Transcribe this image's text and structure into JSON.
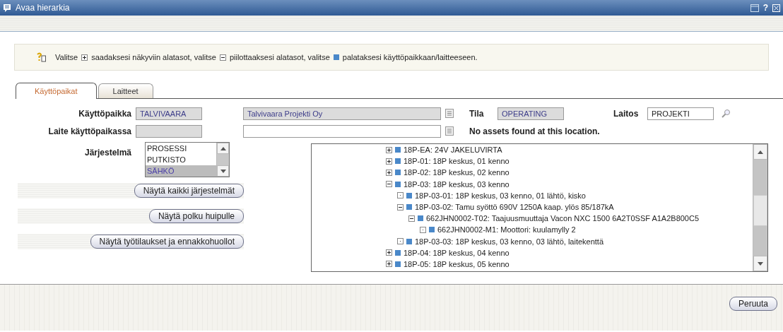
{
  "window": {
    "title": "Avaa hierarkia",
    "help": "?"
  },
  "hint": {
    "segments": [
      {
        "kind": "text",
        "text": "Valitse"
      },
      {
        "kind": "plus"
      },
      {
        "kind": "text",
        "text": "saadaksesi näkyviin alatasot, valitse"
      },
      {
        "kind": "minus"
      },
      {
        "kind": "text",
        "text": "piilottaaksesi alatasot, valitse"
      },
      {
        "kind": "square"
      },
      {
        "kind": "text",
        "text": "palataksesi käyttöpaikkaan/laitteeseen."
      }
    ]
  },
  "tabs": [
    {
      "label": "Käyttöpaikat",
      "selected": true
    },
    {
      "label": "Laitteet",
      "selected": false
    }
  ],
  "form": {
    "location_label": "Käyttöpaikka",
    "location": "TALVIVAARA",
    "location_description": "Talvivaara Projekti Oy",
    "status_label": "Tila",
    "status": "OPERATING",
    "site_label": "Laitos",
    "site": "PROJEKTI",
    "asset_label": "Laite käyttöpaikassa",
    "message": "No assets found at this location."
  },
  "systems": {
    "label": "Järjestelmä",
    "items": [
      {
        "label": "PROSESSI",
        "selected": false
      },
      {
        "label": "PUTKISTO",
        "selected": false
      },
      {
        "label": "SÄHKÖ",
        "selected": true
      }
    ]
  },
  "buttons": [
    "Näytä kaikki järjestelmät",
    "Näytä polku huipulle",
    "Näytä työtilaukset ja ennakkohuollot"
  ],
  "tree": [
    {
      "label": "18P-EA: 24V JAKELUVIRTA",
      "kind": "branch",
      "expanded": false
    },
    {
      "label": "18P-01: 18P keskus, 01 kenno",
      "kind": "branch",
      "expanded": false
    },
    {
      "label": "18P-02: 18P keskus, 02 kenno",
      "kind": "branch",
      "expanded": false
    },
    {
      "label": "18P-03: 18P keskus, 03 kenno",
      "kind": "branch",
      "expanded": true,
      "children": [
        {
          "label": "18P-03-01: 18P keskus, 03 kenno, 01 lähtö, kisko",
          "kind": "leaf"
        },
        {
          "label": "18P-03-02: Tamu syöttö 690V 1250A kaap. ylös 85/187kA",
          "kind": "branch",
          "expanded": true,
          "children": [
            {
              "label": "662JHN0002-T02: Taajuusmuuttaja Vacon NXC 1500 6A2T0SSF A1A2B800C5",
              "kind": "branch",
              "expanded": true,
              "children": [
                {
                  "label": "662JHN0002-M1: Moottori: kuulamylly 2",
                  "kind": "leaf"
                }
              ]
            }
          ]
        },
        {
          "label": "18P-03-03: 18P keskus, 03 kenno, 03 lähtö, laitekenttä",
          "kind": "leaf"
        }
      ]
    },
    {
      "label": "18P-04: 18P keskus, 04 kenno",
      "kind": "branch",
      "expanded": false
    },
    {
      "label": "18P-05: 18P keskus, 05 kenno",
      "kind": "branch",
      "expanded": false
    }
  ],
  "footer": {
    "cancel": "Peruuta"
  }
}
